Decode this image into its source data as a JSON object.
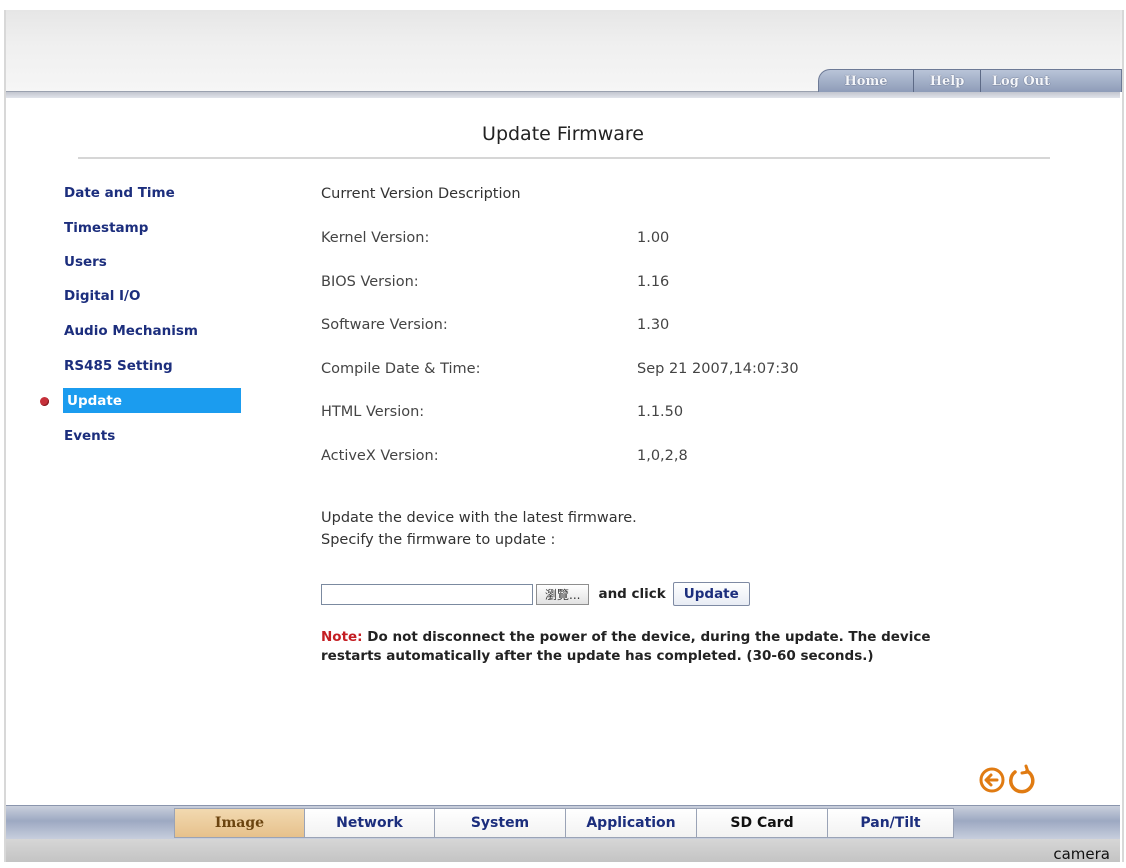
{
  "topnav": {
    "items": [
      {
        "label": "Home"
      },
      {
        "label": "Help"
      },
      {
        "label": "Log Out"
      }
    ]
  },
  "page": {
    "title": "Update Firmware"
  },
  "sidebar": {
    "items": [
      {
        "label": "Date and Time"
      },
      {
        "label": "Timestamp"
      },
      {
        "label": "Users"
      },
      {
        "label": "Digital I/O"
      },
      {
        "label": "Audio Mechanism"
      },
      {
        "label": "RS485 Setting"
      },
      {
        "label": "Update",
        "active": true
      },
      {
        "label": "Events"
      }
    ]
  },
  "versions": {
    "heading": "Current Version Description",
    "rows": [
      {
        "label": "Kernel Version:",
        "value": "1.00"
      },
      {
        "label": "BIOS Version:",
        "value": "1.16"
      },
      {
        "label": "Software Version:",
        "value": "1.30"
      },
      {
        "label": "Compile Date & Time:",
        "value": "Sep 21 2007,14:07:30"
      },
      {
        "label": "HTML Version:",
        "value": "1.1.50"
      },
      {
        "label": "ActiveX Version:",
        "value": "1,0,2,8"
      }
    ]
  },
  "update": {
    "instruction_line1": "Update the device with the latest firmware.",
    "instruction_line2": "Specify the firmware to update :",
    "file_value": "",
    "browse_label": "瀏覽...",
    "and_click": "and click",
    "update_label": "Update"
  },
  "note": {
    "label": "Note:",
    "text": " Do not disconnect the power of the device, during the update. The device restarts automatically after the update has completed. (30-60 seconds.)"
  },
  "bottom_nav": {
    "tabs": [
      {
        "label": "Image"
      },
      {
        "label": "Network"
      },
      {
        "label": "System"
      },
      {
        "label": "Application"
      },
      {
        "label": "SD Card"
      },
      {
        "label": "Pan/Tilt"
      }
    ]
  },
  "footer": {
    "label": "camera"
  },
  "colors": {
    "accent": "#1b9cef",
    "link": "#1c2e7d",
    "note_red": "#c41e23",
    "icon_orange": "#e07b12"
  }
}
